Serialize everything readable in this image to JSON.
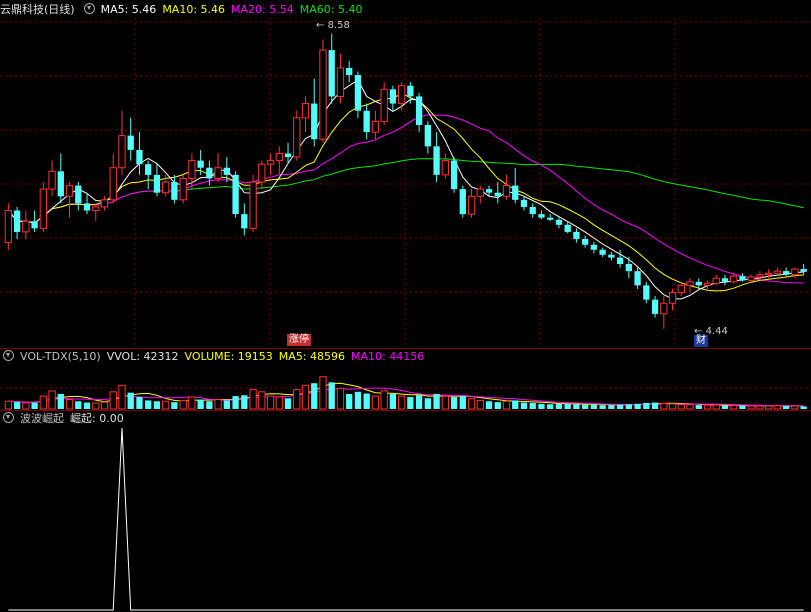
{
  "header_main": {
    "stock_name": "云鼎科技(日线)",
    "ma5": "MA5: 5.46",
    "ma10": "MA10: 5.46",
    "ma20": "MA20: 5.54",
    "ma60": "MA60: 5.40"
  },
  "header_vol": {
    "name": "VOL-TDX(5,10)",
    "vvol": "VVOL: 42312",
    "volume": "VOLUME: 19153",
    "ma5": "MA5: 48596",
    "ma10": "MA10: 44156"
  },
  "header_ind": {
    "name": "波波崛起",
    "value": "崛起: 0.00"
  },
  "annotations": {
    "high_label": "8.58",
    "low_label": "4.44",
    "badge_zt": "涨停",
    "badge_cai": "财"
  },
  "colors": {
    "up": "#ff3232",
    "down": "#54fcfc",
    "ma5": "#ffffff",
    "ma10": "#ffff00",
    "ma20": "#ff00ff",
    "ma60": "#00e600",
    "grid": "#7a0000"
  },
  "chart_data": {
    "type": "candlestick",
    "price_range": [
      4.2,
      8.8
    ],
    "volume_range": [
      0,
      100
    ],
    "indicator_range": [
      0,
      1
    ],
    "candles": [
      [
        5.65,
        6.2,
        5.55,
        6.1
      ],
      [
        6.1,
        6.15,
        5.7,
        5.8
      ],
      [
        5.8,
        6.1,
        5.7,
        5.95
      ],
      [
        5.95,
        6.1,
        5.8,
        5.85
      ],
      [
        5.85,
        6.5,
        5.8,
        6.4
      ],
      [
        6.4,
        6.8,
        6.3,
        6.65
      ],
      [
        6.65,
        6.9,
        6.2,
        6.3
      ],
      [
        6.3,
        6.5,
        6.0,
        6.45
      ],
      [
        6.45,
        6.5,
        6.1,
        6.2
      ],
      [
        6.2,
        6.35,
        6.05,
        6.1
      ],
      [
        6.1,
        6.2,
        5.95,
        6.15
      ],
      [
        6.15,
        6.3,
        6.1,
        6.25
      ],
      [
        6.25,
        6.9,
        6.2,
        6.7
      ],
      [
        6.7,
        7.5,
        6.6,
        7.15
      ],
      [
        7.15,
        7.4,
        6.8,
        6.95
      ],
      [
        6.95,
        7.2,
        6.6,
        6.75
      ],
      [
        6.75,
        6.8,
        6.4,
        6.6
      ],
      [
        6.6,
        6.75,
        6.3,
        6.35
      ],
      [
        6.35,
        6.6,
        6.3,
        6.5
      ],
      [
        6.5,
        6.6,
        6.2,
        6.25
      ],
      [
        6.25,
        6.6,
        6.2,
        6.55
      ],
      [
        6.55,
        6.9,
        6.4,
        6.8
      ],
      [
        6.8,
        6.95,
        6.6,
        6.7
      ],
      [
        6.7,
        6.8,
        6.45,
        6.55
      ],
      [
        6.55,
        6.9,
        6.5,
        6.7
      ],
      [
        6.7,
        6.85,
        6.5,
        6.6
      ],
      [
        6.6,
        6.65,
        6.0,
        6.05
      ],
      [
        6.05,
        6.2,
        5.75,
        5.85
      ],
      [
        5.85,
        6.6,
        5.8,
        6.5
      ],
      [
        6.5,
        6.8,
        6.4,
        6.75
      ],
      [
        6.75,
        6.9,
        6.6,
        6.8
      ],
      [
        6.8,
        7.0,
        6.6,
        6.9
      ],
      [
        6.9,
        7.05,
        6.75,
        6.85
      ],
      [
        6.85,
        7.5,
        6.8,
        7.4
      ],
      [
        7.4,
        7.7,
        7.2,
        7.6
      ],
      [
        7.6,
        7.95,
        7.0,
        7.1
      ],
      [
        7.1,
        8.5,
        7.05,
        8.35
      ],
      [
        8.35,
        8.58,
        7.6,
        7.7
      ],
      [
        7.7,
        8.3,
        7.6,
        8.1
      ],
      [
        8.1,
        8.2,
        7.9,
        8.0
      ],
      [
        8.0,
        8.05,
        7.4,
        7.5
      ],
      [
        7.5,
        7.6,
        7.1,
        7.2
      ],
      [
        7.2,
        7.5,
        7.1,
        7.35
      ],
      [
        7.35,
        7.9,
        7.3,
        7.8
      ],
      [
        7.8,
        7.85,
        7.5,
        7.6
      ],
      [
        7.6,
        7.9,
        7.5,
        7.85
      ],
      [
        7.85,
        7.9,
        7.6,
        7.7
      ],
      [
        7.7,
        7.75,
        7.2,
        7.3
      ],
      [
        7.3,
        7.35,
        6.9,
        7.0
      ],
      [
        7.0,
        7.2,
        6.5,
        6.6
      ],
      [
        6.6,
        6.9,
        6.55,
        6.8
      ],
      [
        6.8,
        6.85,
        6.35,
        6.4
      ],
      [
        6.4,
        6.45,
        6.0,
        6.05
      ],
      [
        6.05,
        6.4,
        6.0,
        6.3
      ],
      [
        6.3,
        6.45,
        6.2,
        6.4
      ],
      [
        6.4,
        6.45,
        6.3,
        6.35
      ],
      [
        6.35,
        6.5,
        6.2,
        6.3
      ],
      [
        6.3,
        6.6,
        6.25,
        6.45
      ],
      [
        6.45,
        6.7,
        6.2,
        6.25
      ],
      [
        6.25,
        6.3,
        6.1,
        6.15
      ],
      [
        6.15,
        6.2,
        6.0,
        6.05
      ],
      [
        6.05,
        6.1,
        5.98,
        6.0
      ],
      [
        6.0,
        6.05,
        5.95,
        5.97
      ],
      [
        5.97,
        6.0,
        5.85,
        5.9
      ],
      [
        5.9,
        5.95,
        5.78,
        5.8
      ],
      [
        5.8,
        5.85,
        5.65,
        5.7
      ],
      [
        5.7,
        5.75,
        5.58,
        5.62
      ],
      [
        5.62,
        5.66,
        5.5,
        5.55
      ],
      [
        5.55,
        5.58,
        5.45,
        5.48
      ],
      [
        5.48,
        5.52,
        5.4,
        5.44
      ],
      [
        5.44,
        5.55,
        5.3,
        5.35
      ],
      [
        5.35,
        5.45,
        5.15,
        5.25
      ],
      [
        5.25,
        5.3,
        5.0,
        5.05
      ],
      [
        5.05,
        5.1,
        4.8,
        4.85
      ],
      [
        4.85,
        4.9,
        4.6,
        4.65
      ],
      [
        4.65,
        4.9,
        4.44,
        4.8
      ],
      [
        4.8,
        5.0,
        4.7,
        4.95
      ],
      [
        4.95,
        5.1,
        4.9,
        5.05
      ],
      [
        5.05,
        5.15,
        4.95,
        5.1
      ],
      [
        5.1,
        5.15,
        5.0,
        5.05
      ],
      [
        5.05,
        5.12,
        5.0,
        5.08
      ],
      [
        5.08,
        5.2,
        5.05,
        5.15
      ],
      [
        5.15,
        5.2,
        5.05,
        5.1
      ],
      [
        5.1,
        5.22,
        5.08,
        5.18
      ],
      [
        5.18,
        5.22,
        5.1,
        5.12
      ],
      [
        5.12,
        5.2,
        5.1,
        5.17
      ],
      [
        5.17,
        5.25,
        5.12,
        5.2
      ],
      [
        5.2,
        5.28,
        5.15,
        5.22
      ],
      [
        5.22,
        5.3,
        5.18,
        5.25
      ],
      [
        5.25,
        5.3,
        5.18,
        5.2
      ],
      [
        5.2,
        5.3,
        5.15,
        5.28
      ],
      [
        5.28,
        5.35,
        5.2,
        5.24
      ]
    ],
    "volumes": [
      18,
      16,
      14,
      15,
      30,
      42,
      35,
      22,
      18,
      15,
      14,
      16,
      40,
      55,
      38,
      28,
      20,
      18,
      18,
      16,
      20,
      28,
      22,
      18,
      22,
      20,
      30,
      32,
      45,
      40,
      30,
      28,
      25,
      45,
      55,
      60,
      75,
      62,
      48,
      35,
      40,
      36,
      30,
      42,
      35,
      30,
      28,
      32,
      25,
      35,
      30,
      28,
      30,
      24,
      20,
      18,
      16,
      18,
      20,
      15,
      14,
      12,
      11,
      12,
      12,
      11,
      10,
      10,
      9,
      9,
      10,
      11,
      12,
      14,
      15,
      13,
      12,
      10,
      10,
      9,
      9,
      9,
      8,
      8,
      8,
      7,
      7,
      7,
      8,
      7,
      7,
      6
    ],
    "indicator": [
      0,
      0,
      0,
      0,
      0,
      0,
      0,
      0,
      0,
      0,
      0,
      0,
      0,
      1,
      0,
      0,
      0,
      0,
      0,
      0,
      0,
      0,
      0,
      0,
      0,
      0,
      0,
      0,
      0,
      0,
      0,
      0,
      0,
      0,
      0,
      0,
      0,
      0,
      0,
      0,
      0,
      0,
      0,
      0,
      0,
      0,
      0,
      0,
      0,
      0,
      0,
      0,
      0,
      0,
      0,
      0,
      0,
      0,
      0,
      0,
      0,
      0,
      0,
      0,
      0,
      0,
      0,
      0,
      0,
      0,
      0,
      0,
      0,
      0,
      0,
      0,
      0,
      0,
      0,
      0,
      0,
      0,
      0,
      0,
      0,
      0,
      0,
      0,
      0,
      0,
      0,
      0
    ]
  }
}
